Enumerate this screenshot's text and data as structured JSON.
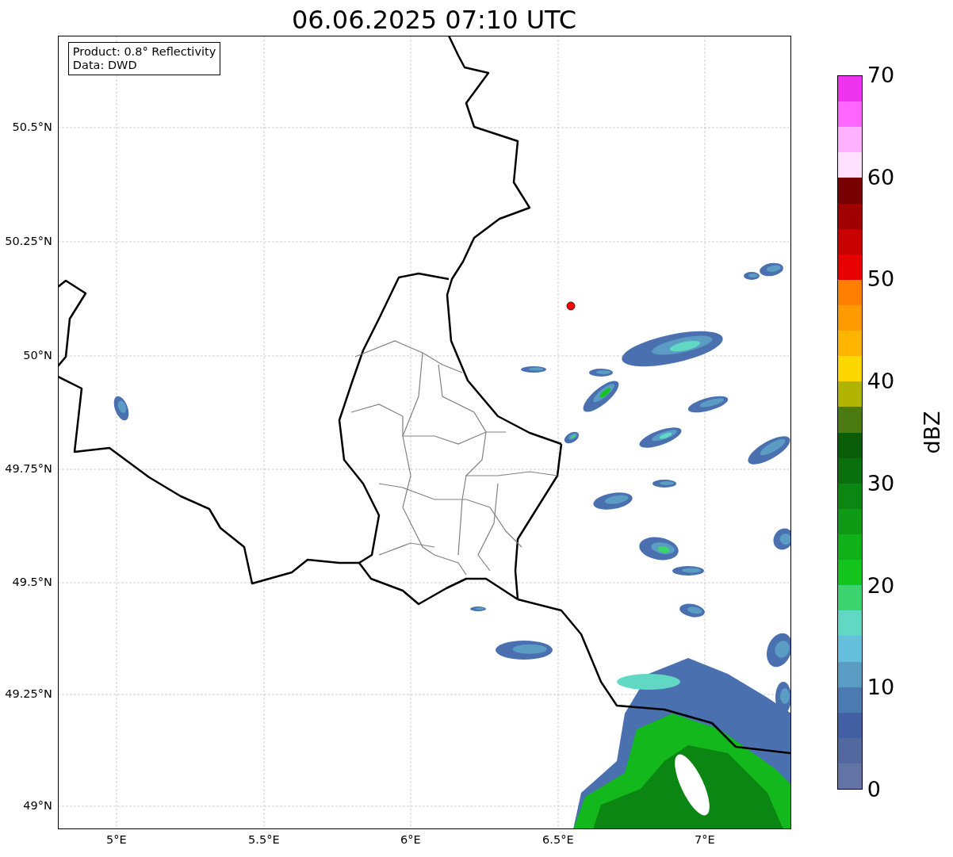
{
  "title": "06.06.2025 07:10 UTC",
  "legend": {
    "lines": [
      "Product: 0.8° Reflectivity",
      "Data: DWD"
    ]
  },
  "map": {
    "lat_ticks": [
      "50.5°N",
      "50.25°N",
      "50°N",
      "49.75°N",
      "49.5°N",
      "49.25°N",
      "49°N"
    ],
    "lon_ticks": [
      "5°E",
      "5.5°E",
      "6°E",
      "6.5°E",
      "7°E"
    ]
  },
  "colorbar": {
    "label": "dBZ",
    "ticks": [
      "70",
      "60",
      "50",
      "40",
      "30",
      "20",
      "10",
      "0"
    ],
    "segments": [
      {
        "color": "#ee33ee"
      },
      {
        "color": "#ff66ff"
      },
      {
        "color": "#ffb0ff"
      },
      {
        "color": "#ffe0ff"
      },
      {
        "color": "#780000"
      },
      {
        "color": "#a00000"
      },
      {
        "color": "#c80000"
      },
      {
        "color": "#e60000"
      },
      {
        "color": "#ff7f00"
      },
      {
        "color": "#ff9a00"
      },
      {
        "color": "#ffb400"
      },
      {
        "color": "#ffd700"
      },
      {
        "color": "#b0b400"
      },
      {
        "color": "#4a7a10"
      },
      {
        "color": "#0a5e0a"
      },
      {
        "color": "#0a700e"
      },
      {
        "color": "#0c8612"
      },
      {
        "color": "#0e9a14"
      },
      {
        "color": "#10b018"
      },
      {
        "color": "#12c41c"
      },
      {
        "color": "#3cd46e"
      },
      {
        "color": "#60d8c4"
      },
      {
        "color": "#64c0dc"
      },
      {
        "color": "#5a9cc4"
      },
      {
        "color": "#4a7ab0"
      },
      {
        "color": "#4460a4"
      },
      {
        "color": "#52689e"
      },
      {
        "color": "#6274a6"
      }
    ]
  }
}
